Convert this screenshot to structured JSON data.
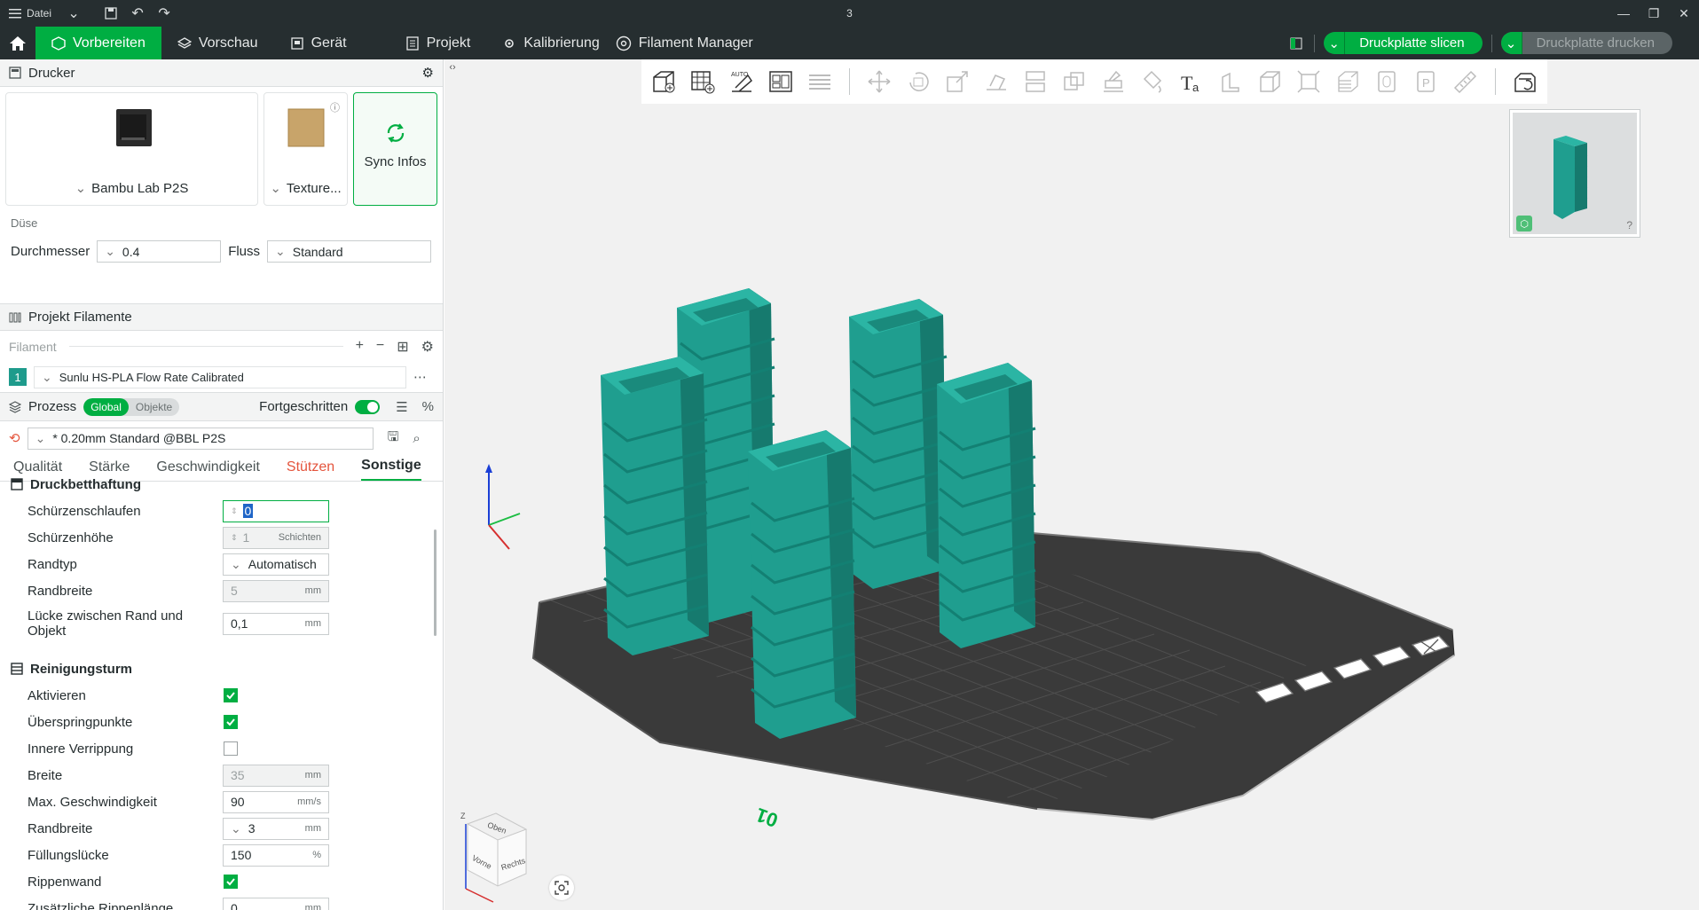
{
  "titlebar": {
    "menu_label": "Datei",
    "title": "3"
  },
  "nav": {
    "tabs": [
      {
        "label": "Vorbereiten"
      },
      {
        "label": "Vorschau"
      },
      {
        "label": "Gerät"
      },
      {
        "label": "Projekt"
      },
      {
        "label": "Kalibrierung"
      },
      {
        "label": "Filament Manager"
      }
    ],
    "slice_label": "Druckplatte slicen",
    "print_label": "Druckplatte drucken"
  },
  "printer": {
    "section_title": "Drucker",
    "name": "Bambu Lab P2S",
    "plate": "Texture...",
    "sync_label": "Sync Infos",
    "nozzle_label": "Düse",
    "diameter_label": "Durchmesser",
    "diameter_value": "0.4",
    "flow_label": "Fluss",
    "flow_value": "Standard"
  },
  "filaments": {
    "section_title": "Projekt Filamente",
    "column_label": "Filament",
    "items": [
      {
        "index": "1",
        "name": "Sunlu HS-PLA Flow Rate Calibrated",
        "color": "#1e9b8c"
      }
    ]
  },
  "process": {
    "title": "Prozess",
    "global_label": "Global",
    "objects_label": "Objekte",
    "advanced_label": "Fortgeschritten",
    "preset": "* 0.20mm Standard @BBL P2S",
    "tabs": [
      "Qualität",
      "Stärke",
      "Geschwindigkeit",
      "Stützen",
      "Sonstige"
    ]
  },
  "groups": {
    "adhesion": {
      "title": "Druckbetthaftung",
      "skirt_loops": {
        "label": "Schürzenschlaufen",
        "value": "0"
      },
      "skirt_height": {
        "label": "Schürzenhöhe",
        "value": "1",
        "unit": "Schichten"
      },
      "brim_type": {
        "label": "Randtyp",
        "value": "Automatisch"
      },
      "brim_width": {
        "label": "Randbreite",
        "value": "5",
        "unit": "mm"
      },
      "brim_gap": {
        "label": "Lücke zwischen Rand und Objekt",
        "value": "0,1",
        "unit": "mm"
      }
    },
    "prime_tower": {
      "title": "Reinigungsturm",
      "enable": {
        "label": "Aktivieren"
      },
      "skip_points": {
        "label": "Überspringpunkte"
      },
      "interlock": {
        "label": "Innere Verrippung"
      },
      "width": {
        "label": "Breite",
        "value": "35",
        "unit": "mm"
      },
      "max_speed": {
        "label": "Max. Geschwindigkeit",
        "value": "90",
        "unit": "mm/s"
      },
      "brim_width": {
        "label": "Randbreite",
        "value": "3",
        "unit": "mm"
      },
      "infill_gap": {
        "label": "Füllungslücke",
        "value": "150",
        "unit": "%"
      },
      "rib_wall": {
        "label": "Rippenwand"
      },
      "extra_rib": {
        "label": "Zusätzliche Rippenlänge",
        "value": "0",
        "unit": "mm"
      }
    }
  },
  "viewport": {
    "plate_number": "01",
    "cube_labels": {
      "top": "Oben",
      "front": "Vorne",
      "right": "Rechts"
    },
    "axis_z": "Z"
  },
  "colors": {
    "accent": "#00ae42",
    "dark": "#262e30",
    "model": "#1f9e8f",
    "bed": "#3a3a3a"
  }
}
